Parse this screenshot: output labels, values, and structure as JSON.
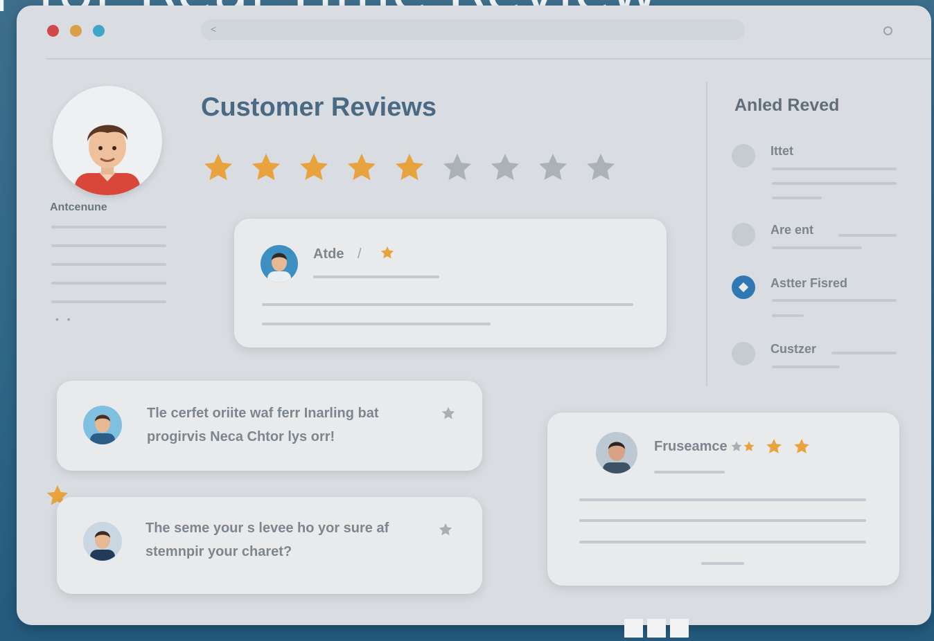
{
  "headline": "r for Real-Time Review",
  "window": {
    "traffic_colors": [
      "#cf4a4a",
      "#d9a04a",
      "#3ea7c5"
    ],
    "address_chevron": "<"
  },
  "profile": {
    "name": "Antcenune"
  },
  "main": {
    "title": "Customer Reviews",
    "rating": {
      "filled": 5,
      "total": 9,
      "filled_color": "#e8a23e",
      "empty_color": "#aab1b7"
    }
  },
  "cards": {
    "top": {
      "name": "Atde",
      "separator": "/"
    },
    "review1": {
      "text": "Tle cerfet oriite waf ferr Inarling bat progirvis Neca Chtor lys orr!"
    },
    "review2": {
      "text": "The seme your s levee ho yor sure af stemnpir your charet?"
    },
    "right": {
      "name": "Fruseamce"
    }
  },
  "sidebar": {
    "title": "Anled Reved",
    "items": [
      {
        "label": "Ittet"
      },
      {
        "label": "Are ent"
      },
      {
        "label": "Astter Fisred"
      },
      {
        "label": "Custzer"
      }
    ]
  }
}
